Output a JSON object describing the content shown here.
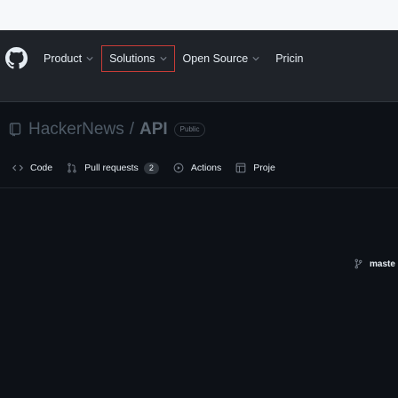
{
  "colors": {
    "page_bg": "#0d1117",
    "header_bg": "#1f2329",
    "accent": "#c93c37",
    "text": "#e6edf3",
    "muted": "#7d8590"
  },
  "header": {
    "logo_icon": "github-logo-icon",
    "nav": [
      {
        "label": "Product",
        "icon": "chevron-down-icon"
      },
      {
        "label": "Solutions",
        "icon": "chevron-down-icon"
      },
      {
        "label": "Open Source",
        "icon": "chevron-down-icon"
      },
      {
        "label": "Pricin"
      }
    ]
  },
  "repo": {
    "icon": "repo-icon",
    "owner": "HackerNews",
    "separator": "/",
    "name": "API",
    "visibility": "Public"
  },
  "tabs": [
    {
      "label": "Code",
      "icon": "code-icon"
    },
    {
      "label": "Pull requests",
      "icon": "pull-request-icon",
      "count": "2"
    },
    {
      "label": "Actions",
      "icon": "play-circle-icon"
    },
    {
      "label": "Proje",
      "icon": "table-icon"
    }
  ],
  "branch": {
    "icon": "branch-icon",
    "label": "maste"
  }
}
